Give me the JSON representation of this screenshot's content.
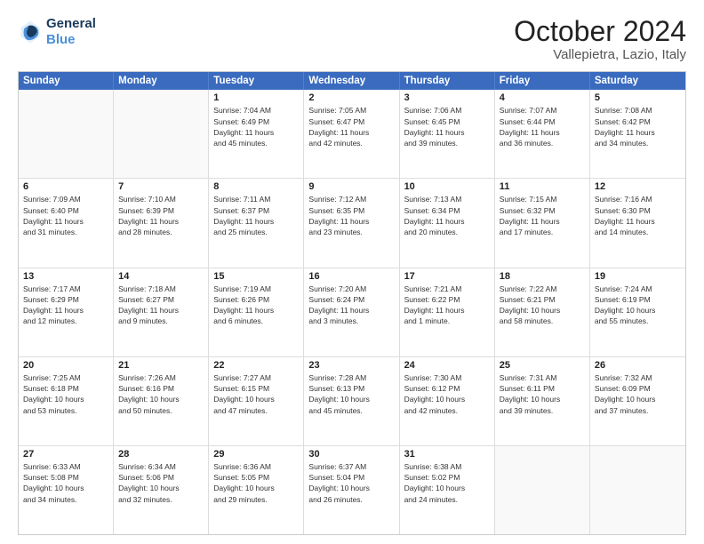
{
  "header": {
    "logo_line1": "General",
    "logo_line2": "Blue",
    "month": "October 2024",
    "location": "Vallepietra, Lazio, Italy"
  },
  "days_of_week": [
    "Sunday",
    "Monday",
    "Tuesday",
    "Wednesday",
    "Thursday",
    "Friday",
    "Saturday"
  ],
  "weeks": [
    [
      {
        "day": "",
        "info": "",
        "empty": true
      },
      {
        "day": "",
        "info": "",
        "empty": true
      },
      {
        "day": "1",
        "info": "Sunrise: 7:04 AM\nSunset: 6:49 PM\nDaylight: 11 hours\nand 45 minutes."
      },
      {
        "day": "2",
        "info": "Sunrise: 7:05 AM\nSunset: 6:47 PM\nDaylight: 11 hours\nand 42 minutes."
      },
      {
        "day": "3",
        "info": "Sunrise: 7:06 AM\nSunset: 6:45 PM\nDaylight: 11 hours\nand 39 minutes."
      },
      {
        "day": "4",
        "info": "Sunrise: 7:07 AM\nSunset: 6:44 PM\nDaylight: 11 hours\nand 36 minutes."
      },
      {
        "day": "5",
        "info": "Sunrise: 7:08 AM\nSunset: 6:42 PM\nDaylight: 11 hours\nand 34 minutes."
      }
    ],
    [
      {
        "day": "6",
        "info": "Sunrise: 7:09 AM\nSunset: 6:40 PM\nDaylight: 11 hours\nand 31 minutes."
      },
      {
        "day": "7",
        "info": "Sunrise: 7:10 AM\nSunset: 6:39 PM\nDaylight: 11 hours\nand 28 minutes."
      },
      {
        "day": "8",
        "info": "Sunrise: 7:11 AM\nSunset: 6:37 PM\nDaylight: 11 hours\nand 25 minutes."
      },
      {
        "day": "9",
        "info": "Sunrise: 7:12 AM\nSunset: 6:35 PM\nDaylight: 11 hours\nand 23 minutes."
      },
      {
        "day": "10",
        "info": "Sunrise: 7:13 AM\nSunset: 6:34 PM\nDaylight: 11 hours\nand 20 minutes."
      },
      {
        "day": "11",
        "info": "Sunrise: 7:15 AM\nSunset: 6:32 PM\nDaylight: 11 hours\nand 17 minutes."
      },
      {
        "day": "12",
        "info": "Sunrise: 7:16 AM\nSunset: 6:30 PM\nDaylight: 11 hours\nand 14 minutes."
      }
    ],
    [
      {
        "day": "13",
        "info": "Sunrise: 7:17 AM\nSunset: 6:29 PM\nDaylight: 11 hours\nand 12 minutes."
      },
      {
        "day": "14",
        "info": "Sunrise: 7:18 AM\nSunset: 6:27 PM\nDaylight: 11 hours\nand 9 minutes."
      },
      {
        "day": "15",
        "info": "Sunrise: 7:19 AM\nSunset: 6:26 PM\nDaylight: 11 hours\nand 6 minutes."
      },
      {
        "day": "16",
        "info": "Sunrise: 7:20 AM\nSunset: 6:24 PM\nDaylight: 11 hours\nand 3 minutes."
      },
      {
        "day": "17",
        "info": "Sunrise: 7:21 AM\nSunset: 6:22 PM\nDaylight: 11 hours\nand 1 minute."
      },
      {
        "day": "18",
        "info": "Sunrise: 7:22 AM\nSunset: 6:21 PM\nDaylight: 10 hours\nand 58 minutes."
      },
      {
        "day": "19",
        "info": "Sunrise: 7:24 AM\nSunset: 6:19 PM\nDaylight: 10 hours\nand 55 minutes."
      }
    ],
    [
      {
        "day": "20",
        "info": "Sunrise: 7:25 AM\nSunset: 6:18 PM\nDaylight: 10 hours\nand 53 minutes."
      },
      {
        "day": "21",
        "info": "Sunrise: 7:26 AM\nSunset: 6:16 PM\nDaylight: 10 hours\nand 50 minutes."
      },
      {
        "day": "22",
        "info": "Sunrise: 7:27 AM\nSunset: 6:15 PM\nDaylight: 10 hours\nand 47 minutes."
      },
      {
        "day": "23",
        "info": "Sunrise: 7:28 AM\nSunset: 6:13 PM\nDaylight: 10 hours\nand 45 minutes."
      },
      {
        "day": "24",
        "info": "Sunrise: 7:30 AM\nSunset: 6:12 PM\nDaylight: 10 hours\nand 42 minutes."
      },
      {
        "day": "25",
        "info": "Sunrise: 7:31 AM\nSunset: 6:11 PM\nDaylight: 10 hours\nand 39 minutes."
      },
      {
        "day": "26",
        "info": "Sunrise: 7:32 AM\nSunset: 6:09 PM\nDaylight: 10 hours\nand 37 minutes."
      }
    ],
    [
      {
        "day": "27",
        "info": "Sunrise: 6:33 AM\nSunset: 5:08 PM\nDaylight: 10 hours\nand 34 minutes."
      },
      {
        "day": "28",
        "info": "Sunrise: 6:34 AM\nSunset: 5:06 PM\nDaylight: 10 hours\nand 32 minutes."
      },
      {
        "day": "29",
        "info": "Sunrise: 6:36 AM\nSunset: 5:05 PM\nDaylight: 10 hours\nand 29 minutes."
      },
      {
        "day": "30",
        "info": "Sunrise: 6:37 AM\nSunset: 5:04 PM\nDaylight: 10 hours\nand 26 minutes."
      },
      {
        "day": "31",
        "info": "Sunrise: 6:38 AM\nSunset: 5:02 PM\nDaylight: 10 hours\nand 24 minutes."
      },
      {
        "day": "",
        "info": "",
        "empty": true
      },
      {
        "day": "",
        "info": "",
        "empty": true
      }
    ]
  ]
}
